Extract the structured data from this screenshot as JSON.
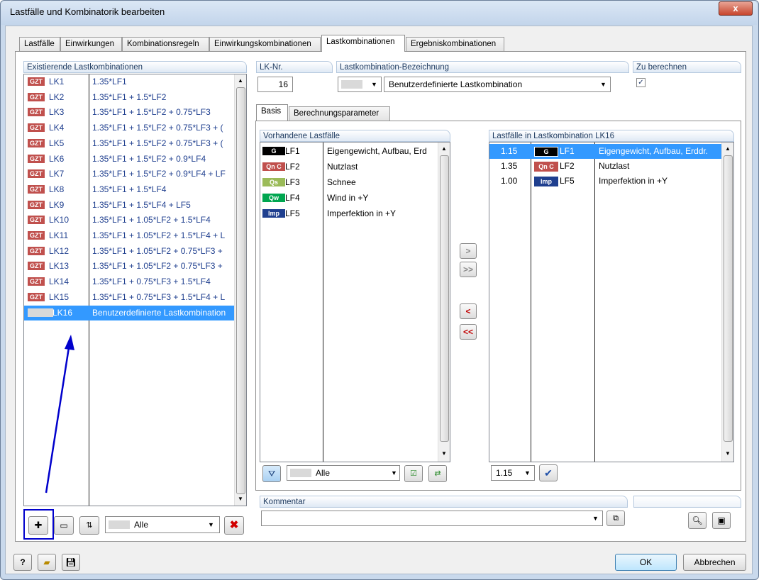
{
  "window": {
    "title": "Lastfälle und Kombinatorik bearbeiten",
    "close_glyph": "x"
  },
  "tabs": [
    "Lastfälle",
    "Einwirkungen",
    "Kombinationsregeln",
    "Einwirkungskombinationen",
    "Lastkombinationen",
    "Ergebniskombinationen"
  ],
  "active_tab": "Lastkombinationen",
  "existing": {
    "header": "Existierende Lastkombinationen",
    "rows": [
      {
        "badge": "GZT",
        "id": "LK1",
        "formula": "1.35*LF1"
      },
      {
        "badge": "GZT",
        "id": "LK2",
        "formula": "1.35*LF1 + 1.5*LF2"
      },
      {
        "badge": "GZT",
        "id": "LK3",
        "formula": "1.35*LF1 + 1.5*LF2 + 0.75*LF3"
      },
      {
        "badge": "GZT",
        "id": "LK4",
        "formula": "1.35*LF1 + 1.5*LF2 + 0.75*LF3 + ("
      },
      {
        "badge": "GZT",
        "id": "LK5",
        "formula": "1.35*LF1 + 1.5*LF2 + 0.75*LF3 + ("
      },
      {
        "badge": "GZT",
        "id": "LK6",
        "formula": "1.35*LF1 + 1.5*LF2 + 0.9*LF4"
      },
      {
        "badge": "GZT",
        "id": "LK7",
        "formula": "1.35*LF1 + 1.5*LF2 + 0.9*LF4 + LF"
      },
      {
        "badge": "GZT",
        "id": "LK8",
        "formula": "1.35*LF1 + 1.5*LF4"
      },
      {
        "badge": "GZT",
        "id": "LK9",
        "formula": "1.35*LF1 + 1.5*LF4 + LF5"
      },
      {
        "badge": "GZT",
        "id": "LK10",
        "formula": "1.35*LF1 + 1.05*LF2 + 1.5*LF4"
      },
      {
        "badge": "GZT",
        "id": "LK11",
        "formula": "1.35*LF1 + 1.05*LF2 + 1.5*LF4 + L"
      },
      {
        "badge": "GZT",
        "id": "LK12",
        "formula": "1.35*LF1 + 1.05*LF2 + 0.75*LF3 +"
      },
      {
        "badge": "GZT",
        "id": "LK13",
        "formula": "1.35*LF1 + 1.05*LF2 + 0.75*LF3 +"
      },
      {
        "badge": "GZT",
        "id": "LK14",
        "formula": "1.35*LF1 + 0.75*LF3 + 1.5*LF4"
      },
      {
        "badge": "GZT",
        "id": "LK15",
        "formula": "1.35*LF1 + 0.75*LF3 + 1.5*LF4 + L"
      },
      {
        "badge": "",
        "id": "LK16",
        "formula": "Benutzerdefinierte Lastkombination"
      }
    ],
    "filter_value": "Alle"
  },
  "lk_nr": {
    "label": "LK-Nr.",
    "value": "16"
  },
  "bezeichnung": {
    "label": "Lastkombination-Bezeichnung",
    "value": "Benutzerdefinierte Lastkombination"
  },
  "zu_berechnen": {
    "label": "Zu berechnen",
    "checked": "✓"
  },
  "subtabs": [
    "Basis",
    "Berechnungsparameter"
  ],
  "vorhandene": {
    "header": "Vorhandene Lastfälle",
    "rows": [
      {
        "badge": "G",
        "color": "#000000",
        "id": "LF1",
        "name": "Eigengewicht, Aufbau, Erd"
      },
      {
        "badge": "Qn C",
        "color": "#c0504d",
        "id": "LF2",
        "name": "Nutzlast"
      },
      {
        "badge": "Qs",
        "color": "#9bbb59",
        "id": "LF3",
        "name": "Schnee"
      },
      {
        "badge": "Qw",
        "color": "#00a650",
        "id": "LF4",
        "name": "Wind in +Y"
      },
      {
        "badge": "Imp",
        "color": "#1f3f8f",
        "id": "LF5",
        "name": "Imperfektion in +Y"
      }
    ],
    "filter_value": "Alle"
  },
  "in_lk": {
    "header": "Lastfälle in Lastkombination LK16",
    "rows": [
      {
        "factor": "1.15",
        "badge": "G",
        "color": "#000000",
        "id": "LF1",
        "name": "Eigengewicht, Aufbau, Erddr."
      },
      {
        "factor": "1.35",
        "badge": "Qn C",
        "color": "#c0504d",
        "id": "LF2",
        "name": "Nutzlast"
      },
      {
        "factor": "1.00",
        "badge": "Imp",
        "color": "#1f3f8f",
        "id": "LF5",
        "name": "Imperfektion in +Y"
      }
    ],
    "factor_value": "1.15"
  },
  "transfer": {
    "add": ">",
    "add_all": ">>",
    "remove": "<",
    "remove_all": "<<"
  },
  "kommentar": {
    "label": "Kommentar",
    "value": ""
  },
  "footer": {
    "ok": "OK",
    "cancel": "Abbrechen",
    "help_glyph": "?"
  },
  "colors": {
    "gzt": "#c0504d",
    "selection": "#3399ff",
    "annotation": "#0000cc"
  }
}
